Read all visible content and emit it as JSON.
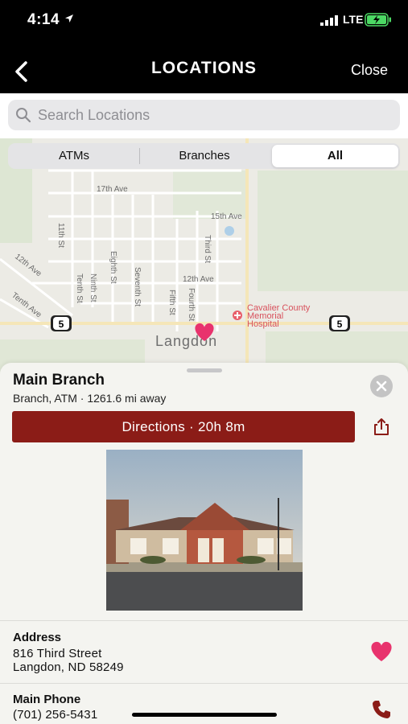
{
  "status_bar": {
    "time": "4:14",
    "network": "LTE"
  },
  "nav": {
    "title": "LOCATIONS",
    "close_label": "Close"
  },
  "search": {
    "placeholder": "Search Locations"
  },
  "segments": {
    "items": [
      {
        "label": "ATMs"
      },
      {
        "label": "Branches"
      },
      {
        "label": "All"
      }
    ],
    "selected": "All"
  },
  "map": {
    "street_labels": [
      "17th Ave",
      "15th Ave",
      "12th Ave",
      "12th Ave",
      "Tenth Ave",
      "11th St",
      "Tenth St",
      "Ninth St",
      "Eighth St",
      "Seventh St",
      "Fifth St",
      "Fourth St",
      "Third St"
    ],
    "hospital_label": [
      "Cavalier County",
      "Memorial",
      "Hospital"
    ],
    "route_shield": "5",
    "city_label": "Langdon"
  },
  "location": {
    "name": "Main Branch",
    "subtitle": "Branch, ATM · 1261.6 mi away",
    "directions_label": "Directions · 20h 8m",
    "address_label": "Address",
    "address_line1": "816 Third Street",
    "address_line2": "Langdon, ND 58249",
    "phone_label": "Main Phone",
    "phone": "(701) 256-5431"
  },
  "colors": {
    "accent": "#8b1c17",
    "favorite": "#e8336d",
    "map_pin": "#e8336d"
  },
  "icons": [
    "back-chevron-icon",
    "search-icon",
    "close-icon",
    "share-icon",
    "heart-icon",
    "phone-icon"
  ]
}
